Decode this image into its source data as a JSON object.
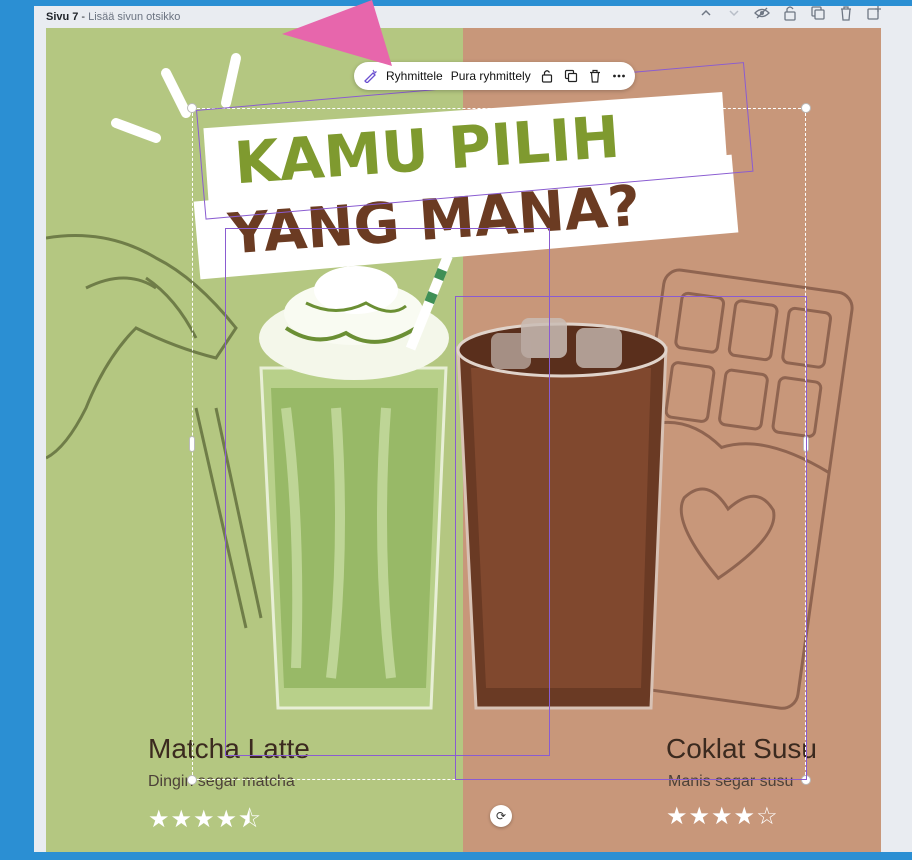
{
  "page_header": {
    "page_label": "Sivu 7",
    "separator": "-",
    "add_title": "Lisää sivun otsikko"
  },
  "page_tools": [
    {
      "name": "chevron-up-icon",
      "glyph": "⌃"
    },
    {
      "name": "chevron-down-icon",
      "glyph": "⌄"
    },
    {
      "name": "hide-icon",
      "glyph": "◈"
    },
    {
      "name": "lock-icon",
      "glyph": "🔓"
    },
    {
      "name": "duplicate-icon",
      "glyph": "⧉"
    },
    {
      "name": "trash-icon",
      "glyph": "🗑"
    },
    {
      "name": "add-page-icon",
      "glyph": "⊕"
    }
  ],
  "toolbar": {
    "group_label": "Ryhmittele",
    "ungroup_label": "Pura ryhmittely"
  },
  "design": {
    "title_line1": "KAMU PILIH",
    "title_line2": "YANG MANA?",
    "left": {
      "name": "Matcha Latte",
      "desc": "Dingin segar matcha",
      "rating": 4.5,
      "stars": "★★★★⯪"
    },
    "right": {
      "name": "Coklat Susu",
      "desc": "Manis segar susu",
      "rating": 4,
      "stars": "★★★★☆"
    }
  },
  "colors": {
    "green_bg": "#b4c781",
    "brown_bg": "#c8977a",
    "title_green": "#7f9a2f",
    "title_brown": "#6b3b22",
    "selection_purple": "#8a5cd1",
    "pointer_pink": "#e766ac",
    "frame_blue": "#2b8fd3"
  }
}
